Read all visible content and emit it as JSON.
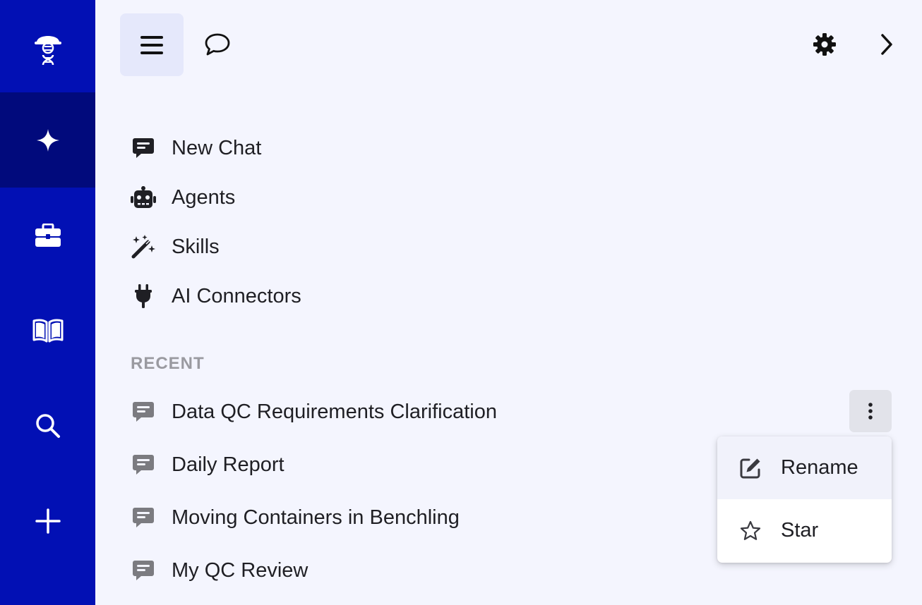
{
  "colors": {
    "rail_bg": "#0210b4",
    "rail_active": "#010a7c",
    "panel_bg": "#f4f5fe",
    "muted_icon": "#7b7b80"
  },
  "rail": {
    "items": [
      {
        "icon": "scientist-logo-icon",
        "active": false
      },
      {
        "icon": "sparkle-icon",
        "active": true
      },
      {
        "icon": "briefcase-icon",
        "active": false
      },
      {
        "icon": "book-icon",
        "active": false
      },
      {
        "icon": "search-icon",
        "active": false
      },
      {
        "icon": "plus-icon",
        "active": false
      }
    ]
  },
  "toolbar": {
    "menu_icon": "hamburger-menu-icon",
    "chat_icon": "chat-bubble-icon",
    "settings_icon": "gear-icon",
    "expand_icon": "chevron-right-icon"
  },
  "nav": {
    "items": [
      {
        "label": "New Chat",
        "icon": "new-chat-icon"
      },
      {
        "label": "Agents",
        "icon": "robot-icon"
      },
      {
        "label": "Skills",
        "icon": "magic-wand-icon"
      },
      {
        "label": "AI Connectors",
        "icon": "plug-icon"
      }
    ]
  },
  "recent": {
    "heading": "RECENT",
    "items": [
      {
        "label": "Data QC Requirements Clarification"
      },
      {
        "label": "Daily Report"
      },
      {
        "label": "Moving Containers in Benchling"
      },
      {
        "label": "My QC Review"
      }
    ]
  },
  "context_menu": {
    "items": [
      {
        "label": "Rename",
        "icon": "edit-icon"
      },
      {
        "label": "Star",
        "icon": "star-icon"
      }
    ]
  }
}
